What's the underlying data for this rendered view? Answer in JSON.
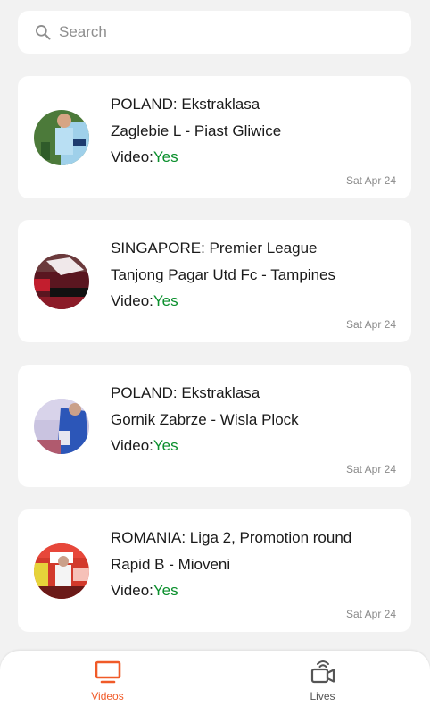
{
  "search": {
    "placeholder": "Search",
    "icon": "search-icon"
  },
  "cards": [
    {
      "league": "POLAND: Ekstraklasa",
      "match": "Zaglebie L - Piast Gliwice",
      "video_label": "Video:",
      "video_value": "Yes",
      "date": "Sat Apr 24"
    },
    {
      "league": "SINGAPORE: Premier League",
      "match": "Tanjong Pagar Utd Fc - Tampines",
      "video_label": "Video:",
      "video_value": "Yes",
      "date": "Sat Apr 24"
    },
    {
      "league": "POLAND: Ekstraklasa",
      "match": "Gornik Zabrze - Wisla Plock",
      "video_label": "Video:",
      "video_value": "Yes",
      "date": "Sat Apr 24"
    },
    {
      "league": "ROMANIA: Liga 2, Promotion round",
      "match": "Rapid B - Mioveni",
      "video_label": "Video:",
      "video_value": "Yes",
      "date": "Sat Apr 24"
    }
  ],
  "nav": {
    "videos_label": "Videos",
    "lives_label": "Lives",
    "active": "Videos"
  },
  "colors": {
    "accent": "#f05a28",
    "video_yes": "#0a8f2c",
    "background": "#f2f2f2"
  }
}
